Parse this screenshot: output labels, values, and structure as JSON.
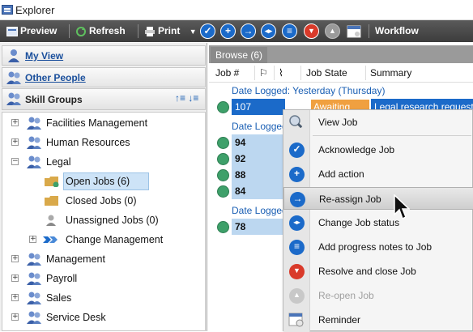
{
  "window": {
    "title": "Explorer"
  },
  "toolbar": {
    "preview": "Preview",
    "refresh": "Refresh",
    "print": "Print",
    "workflow": "Workflow"
  },
  "nav": {
    "my_view": "My View",
    "other_people": "Other People",
    "skill_groups": "Skill Groups"
  },
  "tree": [
    {
      "label": "Facilities Management",
      "expander": "+"
    },
    {
      "label": "Human Resources",
      "expander": "+"
    },
    {
      "label": "Legal",
      "expander": "−"
    },
    {
      "label": "Open Jobs (6)"
    },
    {
      "label": "Closed Jobs (0)"
    },
    {
      "label": "Unassigned Jobs (0)"
    },
    {
      "label": "Change Management",
      "expander": "+"
    },
    {
      "label": "Management",
      "expander": "+"
    },
    {
      "label": "Payroll",
      "expander": "+"
    },
    {
      "label": "Sales",
      "expander": "+"
    },
    {
      "label": "Service Desk",
      "expander": "+"
    }
  ],
  "tab": {
    "label": "Browse (6)"
  },
  "columns": {
    "job": "Job #",
    "state": "Job State",
    "summary": "Summary"
  },
  "groups": [
    {
      "label": "Date Logged:   Yesterday   (Thursday)"
    },
    {
      "label": "Date Logged"
    },
    {
      "label": "Date Logged"
    }
  ],
  "jobs": [
    {
      "num": "107",
      "state": "Awaiting",
      "summary": "Legal research request"
    },
    {
      "num": "94"
    },
    {
      "num": "92"
    },
    {
      "num": "88"
    },
    {
      "num": "84"
    },
    {
      "num": "78"
    }
  ],
  "context_menu": [
    {
      "label": "View Job",
      "icon": "view-job-icon"
    },
    {
      "label": "Acknowledge Job",
      "icon": "acknowledge-icon"
    },
    {
      "label": "Add action",
      "icon": "add-icon"
    },
    {
      "label": "Re-assign Job",
      "icon": "reassign-icon",
      "highlighted": true
    },
    {
      "label": "Change Job status",
      "icon": "change-status-icon"
    },
    {
      "label": "Add progress notes to Job",
      "icon": "notes-icon"
    },
    {
      "label": "Resolve and close Job",
      "icon": "resolve-icon"
    },
    {
      "label": "Re-open Job",
      "icon": "reopen-icon",
      "disabled": true
    },
    {
      "label": "Reminder",
      "icon": "reminder-icon"
    }
  ],
  "colors": {
    "accent_blue": "#1b6ac9",
    "green_status": "#3ea06a",
    "orange_state": "#f0a040",
    "toolbar_dark": "#4a4a4a"
  }
}
